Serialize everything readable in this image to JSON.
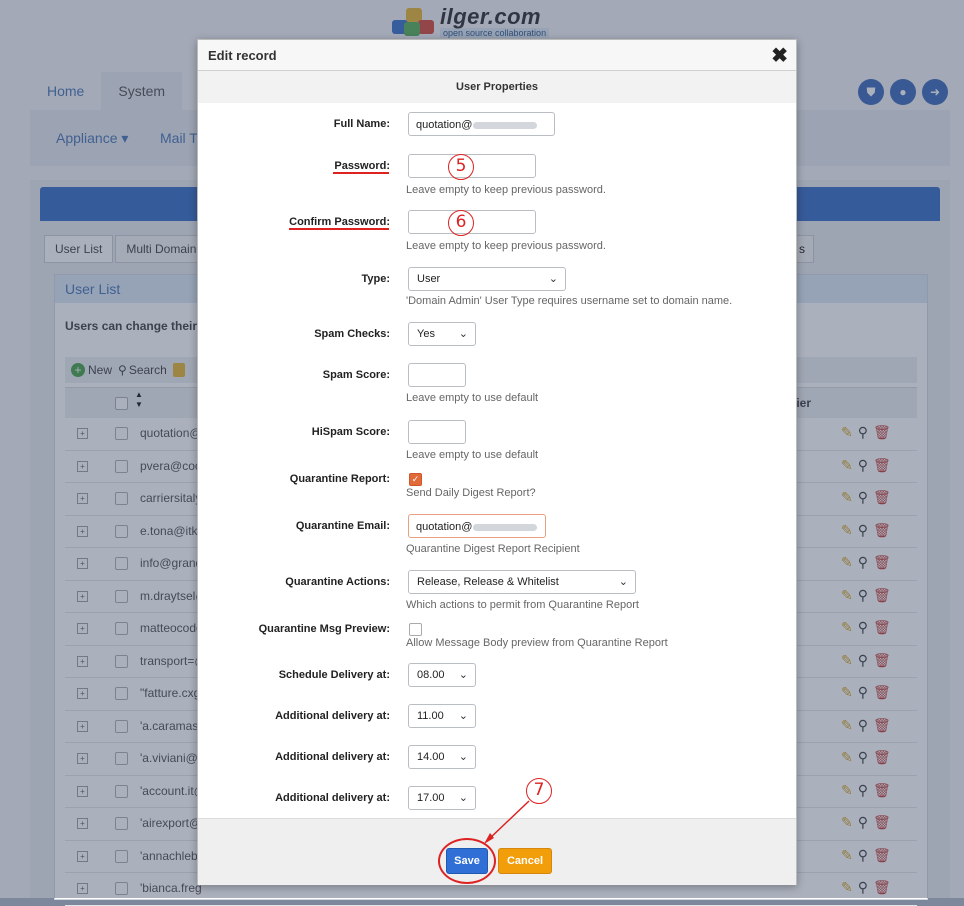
{
  "brand": {
    "name": "ilger.com",
    "tagline": "open source collaboration"
  },
  "top_tabs": [
    "Home",
    "System"
  ],
  "subnav": {
    "appliance": "Appliance",
    "mail": "Mail T"
  },
  "sub_tabs": [
    "User List",
    "Multi Domain",
    "s"
  ],
  "list": {
    "title": "User List",
    "note": "Users can change their c",
    "toolbar": {
      "new": "New",
      "search": "Search"
    },
    "col_notifier": "tifier",
    "rows": [
      "quotation@",
      "pvera@coo",
      "carriersitaly",
      "e.tona@itkz",
      "info@grand",
      "m.draytsel@",
      "matteocodo",
      "transport=@",
      "\"fatture.cxg",
      "'a.caramasc",
      "'a.viviani@c",
      "'account.it@",
      "'airexport@",
      "'annachlebr",
      "'bianca.freg"
    ]
  },
  "modal": {
    "title": "Edit record",
    "close": "✖",
    "section": "User Properties",
    "fields": {
      "full_name": {
        "label": "Full Name:",
        "value": "quotation@"
      },
      "password": {
        "label": "Password:",
        "hint": "Leave empty to keep previous password."
      },
      "confirm_password": {
        "label": "Confirm Password:",
        "hint": "Leave empty to keep previous password."
      },
      "type": {
        "label": "Type:",
        "value": "User",
        "hint": "'Domain Admin' User Type requires username set to domain name."
      },
      "spam_checks": {
        "label": "Spam Checks:",
        "value": "Yes"
      },
      "spam_score": {
        "label": "Spam Score:",
        "hint": "Leave empty to use default"
      },
      "hispam_score": {
        "label": "HiSpam Score:",
        "hint": "Leave empty to use default"
      },
      "quarantine_report": {
        "label": "Quarantine Report:",
        "checked": true,
        "hint": "Send Daily Digest Report?"
      },
      "quarantine_email": {
        "label": "Quarantine Email:",
        "value": "quotation@",
        "hint": "Quarantine Digest Report Recipient"
      },
      "quarantine_actions": {
        "label": "Quarantine Actions:",
        "value": "Release, Release & Whitelist",
        "hint": "Which actions to permit from Quarantine Report"
      },
      "quarantine_preview": {
        "label": "Quarantine Msg Preview:",
        "checked": false,
        "hint": "Allow Message Body preview from Quarantine Report"
      },
      "schedule_delivery": {
        "label": "Schedule Delivery at:",
        "value": "08.00"
      },
      "additional_1": {
        "label": "Additional delivery at:",
        "value": "11.00"
      },
      "additional_2": {
        "label": "Additional delivery at:",
        "value": "14.00"
      },
      "additional_3": {
        "label": "Additional delivery at:",
        "value": "17.00"
      }
    },
    "buttons": {
      "save": "Save",
      "cancel": "Cancel"
    }
  },
  "annotations": {
    "step5": "5",
    "step6": "6",
    "step7": "7",
    "color": "#dd2222"
  }
}
